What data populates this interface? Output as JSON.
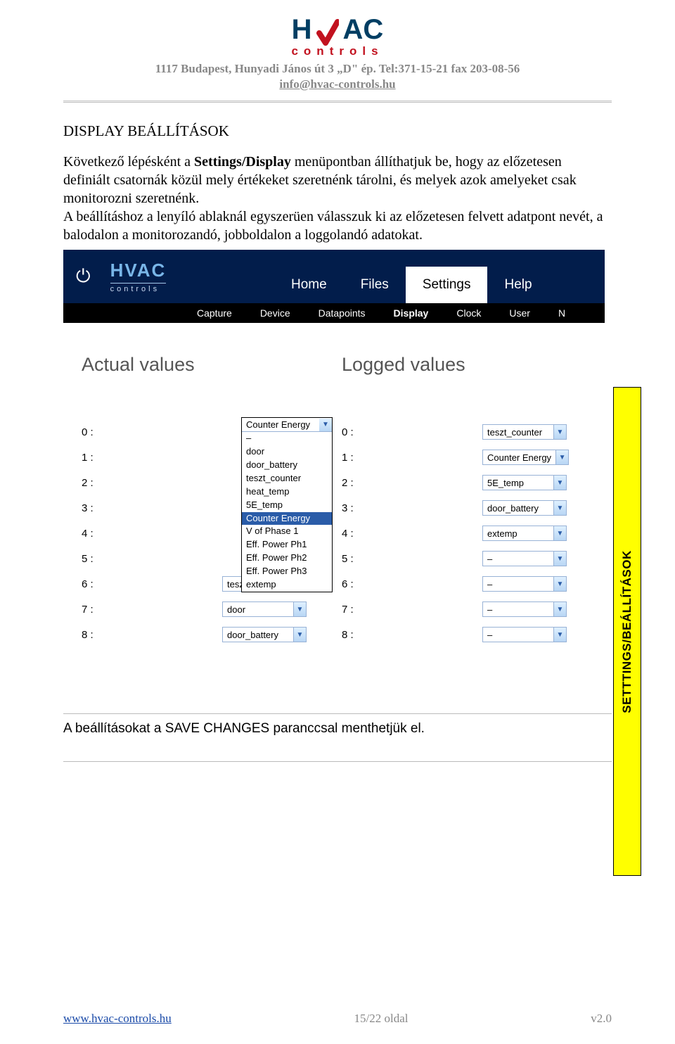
{
  "header": {
    "company_line": "1117 Budapest, Hunyadi János út 3 „D\" ép. Tel:371-15-21 fax 203-08-56",
    "email": "info@hvac-controls.hu",
    "logo_main_left": "H",
    "logo_main_right": "AC",
    "logo_sub": "controls"
  },
  "section_title": "DISPLAY BEÁLLÍTÁSOK",
  "body_para_prefix": "Következő lépésként a ",
  "body_para_bold": "Settings/Display",
  "body_para_suffix": " menüpontban állíthatjuk be, hogy az előzetesen definiált csatornák közül mely értékeket szeretnénk tárolni, és melyek azok amelyeket csak monitorozni szeretnénk.",
  "body_para2": "A beállításhoz a lenyíló ablaknál egyszerüen válasszuk ki az előzetesen felvett adatpont nevét, a balodalon a monitorozandó, jobboldalon a loggolandó adatokat.",
  "sidetab": "SETTTINGS/BEÁLLÍTÁSOK",
  "screenshot": {
    "mainnav": [
      "Home",
      "Files",
      "Settings",
      "Help"
    ],
    "mainnav_active": "Settings",
    "subnav": [
      "Capture",
      "Device",
      "Datapoints",
      "Display",
      "Clock",
      "User",
      "N"
    ],
    "subnav_active": "Display",
    "logo_main": "HVAC",
    "logo_sub": "controls",
    "col_headers": [
      "Actual values",
      "Logged values"
    ],
    "dropdown_selected": "Counter Energy",
    "dropdown_options": [
      "–",
      "door",
      "door_battery",
      "teszt_counter",
      "heat_temp",
      "5E_temp",
      "Counter Energy",
      "V of Phase 1",
      "Eff. Power Ph1",
      "Eff. Power Ph2",
      "Eff. Power Ph3",
      "extemp"
    ],
    "left_rows": [
      {
        "label": "0 :",
        "value": "Counter Energy",
        "open": true
      },
      {
        "label": "1 :",
        "value": ""
      },
      {
        "label": "2 :",
        "value": ""
      },
      {
        "label": "3 :",
        "value": ""
      },
      {
        "label": "4 :",
        "value": ""
      },
      {
        "label": "5 :",
        "value": ""
      },
      {
        "label": "6 :",
        "value": "teszt_counter"
      },
      {
        "label": "7 :",
        "value": "door"
      },
      {
        "label": "8 :",
        "value": "door_battery"
      }
    ],
    "right_rows": [
      {
        "label": "0 :",
        "value": "teszt_counter"
      },
      {
        "label": "1 :",
        "value": "Counter Energy"
      },
      {
        "label": "2 :",
        "value": "5E_temp"
      },
      {
        "label": "3 :",
        "value": "door_battery"
      },
      {
        "label": "4 :",
        "value": "extemp"
      },
      {
        "label": "5 :",
        "value": "–"
      },
      {
        "label": "6 :",
        "value": "–"
      },
      {
        "label": "7 :",
        "value": "–"
      },
      {
        "label": "8 :",
        "value": "–"
      }
    ]
  },
  "save_note": "A beállításokat a SAVE CHANGES paranccsal menthetjük el.",
  "footer": {
    "left": "www.hvac-controls.hu",
    "center": "15/22 oldal",
    "right": "v2.0"
  }
}
